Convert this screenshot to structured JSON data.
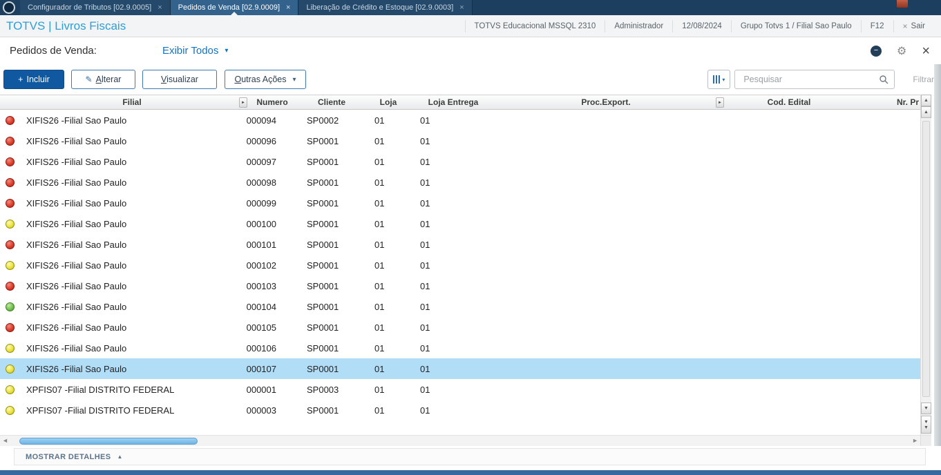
{
  "colors": {
    "accent_blue": "#10589f",
    "brand_blue": "#2b9fd8",
    "selected_row": "#b2ddf7",
    "status_red": "#dd3e2b",
    "status_yellow": "#ece33e",
    "status_green": "#74c24f",
    "tabbar_bg": "#1d3f5f",
    "bottom_bar": "#35699f"
  },
  "icons": {
    "plus": "+",
    "pencil": "✎",
    "caret_down": "▾",
    "gear": "⚙",
    "close": "×",
    "minus": "−",
    "up_arrow": "▲",
    "down_arrow": "▼",
    "left_arrow": "◄",
    "right_arrow": "►",
    "detail_collapse": "▲"
  },
  "tabbar": {
    "tabs": [
      {
        "label": "Configurador de Tributos [02.9.0005]",
        "close": "×",
        "active": false
      },
      {
        "label": "Pedidos de Venda [02.9.0009]",
        "close": "×",
        "active": true
      },
      {
        "label": "Liberação de Crédito e Estoque [02.9.0003]",
        "close": "×",
        "active": false
      }
    ]
  },
  "header": {
    "brand": "TOTVS | Livros Fiscais",
    "environment": "TOTVS Educacional MSSQL 2310",
    "user": "Administrador",
    "date": "12/08/2024",
    "branch": "Grupo Totvs 1 / Filial Sao Paulo",
    "f12": "F12",
    "exit_label": "Sair"
  },
  "titlebar": {
    "title": "Pedidos de Venda:",
    "view_selector": "Exibir Todos"
  },
  "toolbar": {
    "incluir": "Incluir",
    "alterar_initial": "A",
    "alterar_rest": "lterar",
    "visualizar_initial": "V",
    "visualizar_rest": "isualizar",
    "outras_initial": "O",
    "outras_rest": "utras Ações",
    "search_placeholder": "Pesquisar",
    "search_value": "",
    "filtrar": "Filtrar"
  },
  "table": {
    "columns": [
      "Filial",
      "Numero",
      "Cliente",
      "Loja",
      "Loja Entrega",
      "Proc.Export.",
      "Cod. Edital",
      "Nr. Pr"
    ],
    "rows": [
      {
        "status": "red",
        "filial": "XIFIS26 -Filial Sao Paulo",
        "numero": "000094",
        "cliente": "SP0002",
        "loja": "01",
        "loja_entrega": "01",
        "proc_export": "",
        "cod_edital": "",
        "nr_pr": "",
        "selected": false
      },
      {
        "status": "red",
        "filial": "XIFIS26 -Filial Sao Paulo",
        "numero": "000096",
        "cliente": "SP0001",
        "loja": "01",
        "loja_entrega": "01",
        "proc_export": "",
        "cod_edital": "",
        "nr_pr": "",
        "selected": false
      },
      {
        "status": "red",
        "filial": "XIFIS26 -Filial Sao Paulo",
        "numero": "000097",
        "cliente": "SP0001",
        "loja": "01",
        "loja_entrega": "01",
        "proc_export": "",
        "cod_edital": "",
        "nr_pr": "",
        "selected": false
      },
      {
        "status": "red",
        "filial": "XIFIS26 -Filial Sao Paulo",
        "numero": "000098",
        "cliente": "SP0001",
        "loja": "01",
        "loja_entrega": "01",
        "proc_export": "",
        "cod_edital": "",
        "nr_pr": "",
        "selected": false
      },
      {
        "status": "red",
        "filial": "XIFIS26 -Filial Sao Paulo",
        "numero": "000099",
        "cliente": "SP0001",
        "loja": "01",
        "loja_entrega": "01",
        "proc_export": "",
        "cod_edital": "",
        "nr_pr": "",
        "selected": false
      },
      {
        "status": "yellow",
        "filial": "XIFIS26 -Filial Sao Paulo",
        "numero": "000100",
        "cliente": "SP0001",
        "loja": "01",
        "loja_entrega": "01",
        "proc_export": "",
        "cod_edital": "",
        "nr_pr": "",
        "selected": false
      },
      {
        "status": "red",
        "filial": "XIFIS26 -Filial Sao Paulo",
        "numero": "000101",
        "cliente": "SP0001",
        "loja": "01",
        "loja_entrega": "01",
        "proc_export": "",
        "cod_edital": "",
        "nr_pr": "",
        "selected": false
      },
      {
        "status": "yellow",
        "filial": "XIFIS26 -Filial Sao Paulo",
        "numero": "000102",
        "cliente": "SP0001",
        "loja": "01",
        "loja_entrega": "01",
        "proc_export": "",
        "cod_edital": "",
        "nr_pr": "",
        "selected": false
      },
      {
        "status": "red",
        "filial": "XIFIS26 -Filial Sao Paulo",
        "numero": "000103",
        "cliente": "SP0001",
        "loja": "01",
        "loja_entrega": "01",
        "proc_export": "",
        "cod_edital": "",
        "nr_pr": "",
        "selected": false
      },
      {
        "status": "green",
        "filial": "XIFIS26 -Filial Sao Paulo",
        "numero": "000104",
        "cliente": "SP0001",
        "loja": "01",
        "loja_entrega": "01",
        "proc_export": "",
        "cod_edital": "",
        "nr_pr": "",
        "selected": false
      },
      {
        "status": "red",
        "filial": "XIFIS26 -Filial Sao Paulo",
        "numero": "000105",
        "cliente": "SP0001",
        "loja": "01",
        "loja_entrega": "01",
        "proc_export": "",
        "cod_edital": "",
        "nr_pr": "",
        "selected": false
      },
      {
        "status": "yellow",
        "filial": "XIFIS26 -Filial Sao Paulo",
        "numero": "000106",
        "cliente": "SP0001",
        "loja": "01",
        "loja_entrega": "01",
        "proc_export": "",
        "cod_edital": "",
        "nr_pr": "",
        "selected": false
      },
      {
        "status": "yellow",
        "filial": "XIFIS26 -Filial Sao Paulo",
        "numero": "000107",
        "cliente": "SP0001",
        "loja": "01",
        "loja_entrega": "01",
        "proc_export": "",
        "cod_edital": "",
        "nr_pr": "",
        "selected": true
      },
      {
        "status": "yellow",
        "filial": "XPFIS07 -Filial DISTRITO FEDERAL",
        "numero": "000001",
        "cliente": "SP0003",
        "loja": "01",
        "loja_entrega": "01",
        "proc_export": "",
        "cod_edital": "",
        "nr_pr": "",
        "selected": false
      },
      {
        "status": "yellow",
        "filial": "XPFIS07 -Filial DISTRITO FEDERAL",
        "numero": "000003",
        "cliente": "SP0001",
        "loja": "01",
        "loja_entrega": "01",
        "proc_export": "",
        "cod_edital": "",
        "nr_pr": "",
        "selected": false
      }
    ]
  },
  "footer": {
    "mostrar_detalhes": "MOSTRAR DETALHES"
  }
}
